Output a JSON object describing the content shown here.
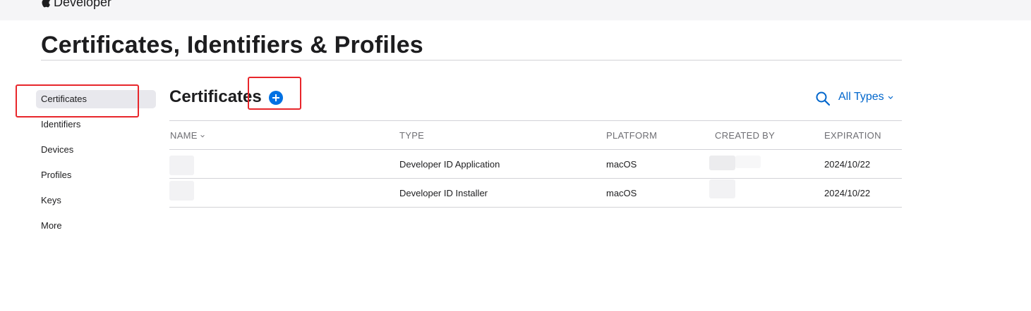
{
  "header": {
    "brand": "Developer"
  },
  "page_title": "Certificates, Identifiers & Profiles",
  "sidebar": {
    "items": [
      {
        "label": "Certificates",
        "active": true
      },
      {
        "label": "Identifiers"
      },
      {
        "label": "Devices"
      },
      {
        "label": "Profiles"
      },
      {
        "label": "Keys"
      },
      {
        "label": "More"
      }
    ]
  },
  "main": {
    "section_title": "Certificates",
    "filter_label": "All Types",
    "columns": [
      "NAME",
      "TYPE",
      "PLATFORM",
      "CREATED BY",
      "EXPIRATION"
    ],
    "rows": [
      {
        "name": "",
        "type": "Developer ID Application",
        "platform": "macOS",
        "created_by": "",
        "expiration": "2024/10/22"
      },
      {
        "name": "",
        "type": "Developer ID Installer",
        "platform": "macOS",
        "created_by": "",
        "expiration": "2024/10/22"
      }
    ]
  },
  "colors": {
    "accent": "#0071e3",
    "link": "#0066cc",
    "annotation": "#e8262b",
    "active_bg": "#e8e8ed"
  }
}
